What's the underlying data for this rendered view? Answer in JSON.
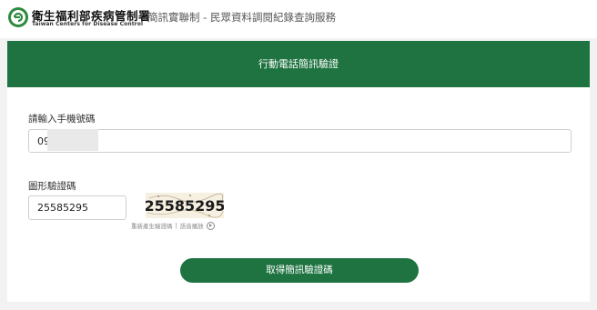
{
  "header": {
    "org_name": "衛生福利部疾病管制署",
    "org_subtitle": "Taiwan Centers for Disease Control",
    "service_title": "簡訊實聯制 - 民眾資料調閱紀錄查詢服務",
    "logo_icon": "cdc-logo-icon",
    "brand_color": "#1e7340"
  },
  "banner": {
    "title": "行動電話簡訊驗證"
  },
  "form": {
    "phone_label": "請輸入手機號碼",
    "phone_value": "09",
    "captcha_label": "圖形驗證碼",
    "captcha_value": "25585295",
    "captcha_image_text": "25585295",
    "refresh_link": "重新產生驗證碼",
    "separator": "|",
    "audio_link": "語音播放",
    "audio_icon": "play-circle-icon",
    "submit_label": "取得簡訊驗證碼"
  }
}
